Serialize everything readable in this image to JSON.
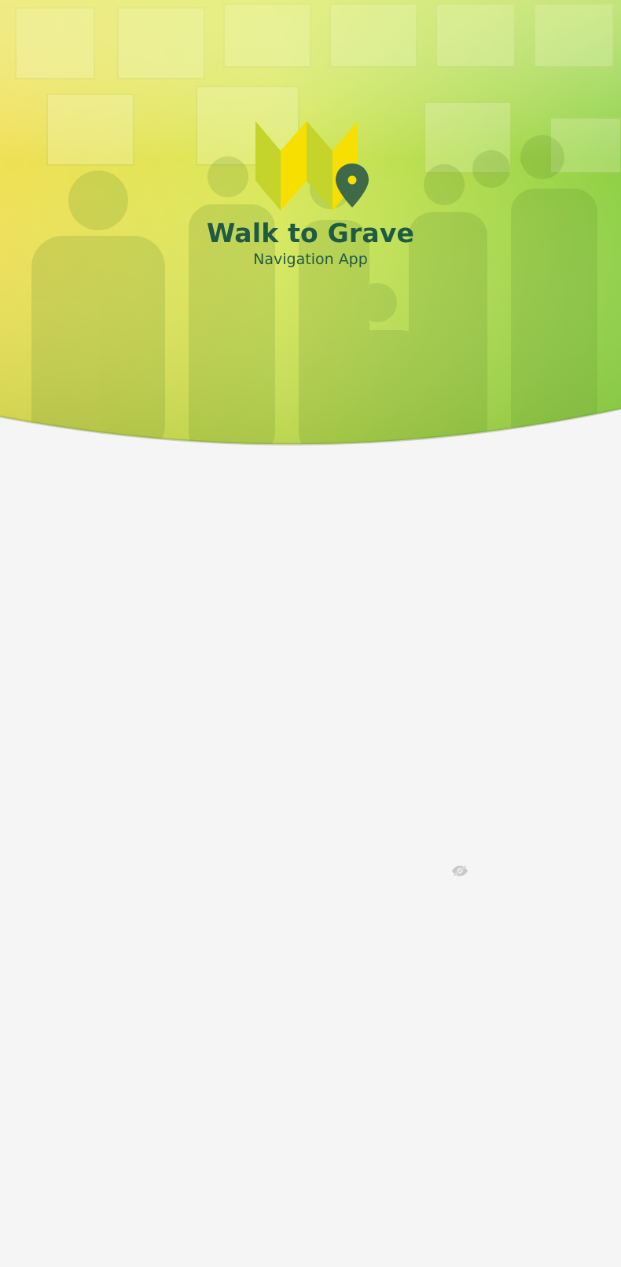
{
  "app": {
    "title": "Walk to Grave",
    "subtitle": "Navigation App"
  },
  "icons": {
    "logo": "folded-map-with-location-pin-logo",
    "visibility": "eye-off-icon"
  },
  "colors": {
    "background": "#f5f5f5",
    "hero_gradient_left": "#f2e45a",
    "hero_gradient_right": "#86cf3e",
    "title_color": "#1f5a45",
    "logo_yellow": "#f7e000",
    "logo_lime": "#c4d42a",
    "pin_color": "#3f6a4a"
  }
}
